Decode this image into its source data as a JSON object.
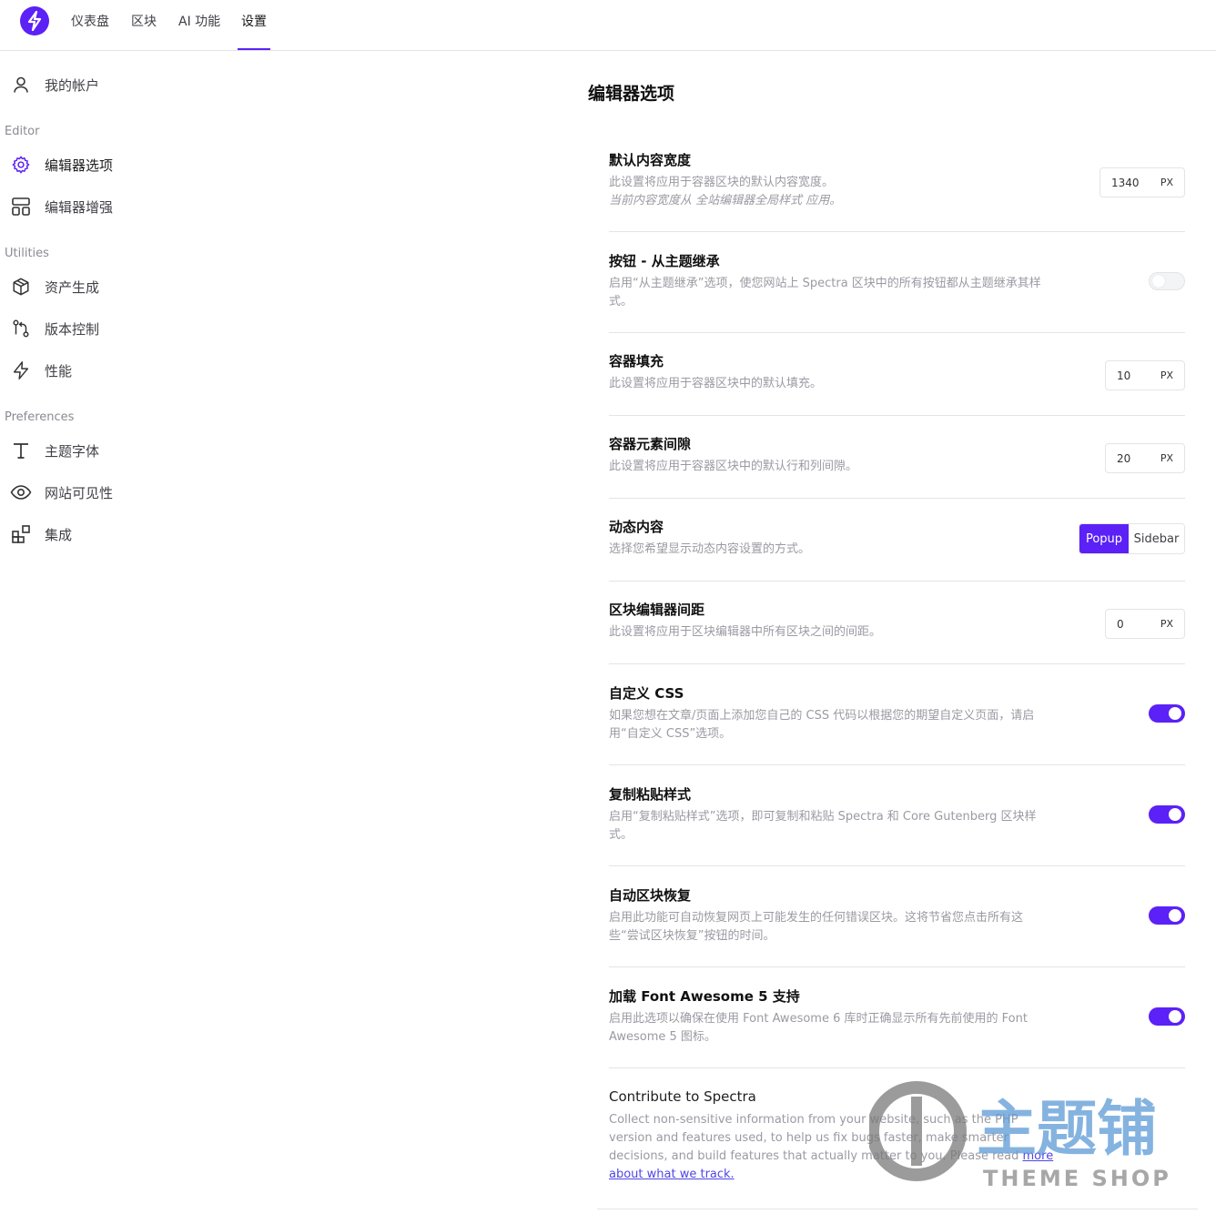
{
  "topnav": {
    "items": [
      "仪表盘",
      "区块",
      "AI 功能",
      "设置"
    ],
    "active": "设置"
  },
  "sidebar": {
    "account": "我的帐户",
    "sections": {
      "editor": "Editor",
      "utilities": "Utilities",
      "preferences": "Preferences"
    },
    "editor_items": [
      "编辑器选项",
      "编辑器增强"
    ],
    "utilities_items": [
      "资产生成",
      "版本控制",
      "性能"
    ],
    "preferences_items": [
      "主题字体",
      "网站可见性",
      "集成"
    ],
    "active": "编辑器选项",
    "accent_color": "#5b21f6"
  },
  "main": {
    "title": "编辑器选项",
    "settings": [
      {
        "title": "默认内容宽度",
        "desc": "此设置将应用于容器区块的默认内容宽度。",
        "note": "当前内容宽度从 全站编辑器全局样式 应用。",
        "value": "1340",
        "unit": "PX"
      },
      {
        "title": "按钮 - 从主题继承",
        "desc": "启用“从主题继承”选项，使您网站上 Spectra 区块中的所有按钮都从主题继承其样式。",
        "toggle": false
      },
      {
        "title": "容器填充",
        "desc": "此设置将应用于容器区块中的默认填充。",
        "value": "10",
        "unit": "PX"
      },
      {
        "title": "容器元素间隙",
        "desc": "此设置将应用于容器区块中的默认行和列间隙。",
        "value": "20",
        "unit": "PX"
      },
      {
        "title": "动态内容",
        "desc": "选择您希望显示动态内容设置的方式。",
        "options": [
          "Popup",
          "Sidebar"
        ],
        "selected": "Popup"
      },
      {
        "title": "区块编辑器间距",
        "desc": "此设置将应用于区块编辑器中所有区块之间的间距。",
        "value": "0",
        "unit": "PX"
      },
      {
        "title": "自定义 CSS",
        "desc": "如果您想在文章/页面上添加您自己的 CSS 代码以根据您的期望自定义页面，请启用“自定义 CSS”选项。",
        "toggle": true
      },
      {
        "title": "复制粘贴样式",
        "desc": "启用“复制粘贴样式”选项，即可复制和粘贴 Spectra 和 Core Gutenberg 区块样式。",
        "toggle": true
      },
      {
        "title": "自动区块恢复",
        "desc": "启用此功能可自动恢复网页上可能发生的任何错误区块。这将节省您点击所有这些“尝试区块恢复”按钮的时间。",
        "toggle": true
      },
      {
        "title": "加载 Font Awesome 5 支持",
        "desc": "启用此选项以确保在使用 Font Awesome 6 库时正确显示所有先前使用的 Font Awesome 5 图标。",
        "toggle": true
      },
      {
        "title": "Contribute to Spectra",
        "desc": "Collect non-sensitive information from your website, such as the PHP version and features used, to help us fix bugs faster, make smarter decisions, and build features that actually matter to you. Please read ",
        "link": "more about what we track."
      }
    ]
  },
  "watermark": {
    "brand": "主题铺",
    "sub": "THEME SHOP"
  }
}
